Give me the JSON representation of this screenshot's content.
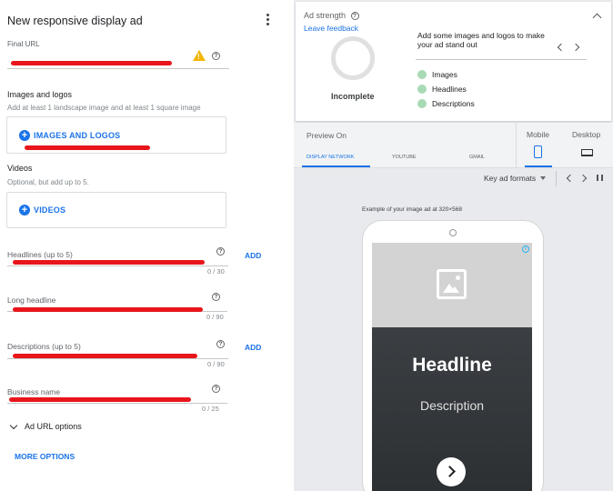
{
  "left": {
    "title": "New responsive display ad",
    "final_url": {
      "label": "Final URL"
    },
    "images": {
      "heading": "Images and logos",
      "sub": "Add at least 1 landscape image and at least 1 square image",
      "button": "IMAGES AND LOGOS"
    },
    "videos": {
      "heading": "Videos",
      "sub": "Optional, but add up to 5.",
      "button": "VIDEOS"
    },
    "headlines": {
      "label": "Headlines (up to 5)",
      "count": "0 / 30",
      "add": "ADD"
    },
    "long_headline": {
      "label": "Long headline",
      "count": "0 / 90"
    },
    "descriptions": {
      "label": "Descriptions (up to 5)",
      "count": "0 / 90",
      "add": "ADD"
    },
    "business_name": {
      "label": "Business name",
      "count": "0 / 25"
    },
    "ad_url_options": "Ad URL options",
    "more_options": "MORE OPTIONS"
  },
  "strength": {
    "title": "Ad strength",
    "feedback": "Leave feedback",
    "status": "Incomplete",
    "tip": "Add some images and logos to make your ad stand out",
    "items": [
      "Images",
      "Headlines",
      "Descriptions"
    ]
  },
  "preview": {
    "preview_on": "Preview On",
    "networks": [
      "DISPLAY NETWORK",
      "YOUTUBE",
      "GMAIL"
    ],
    "devices": [
      "Mobile",
      "Desktop"
    ],
    "formats": "Key ad formats",
    "example": "Example of your image ad at 320×568",
    "ad": {
      "headline": "Headline",
      "description": "Description"
    }
  },
  "colors": {
    "accent": "#1a73e8",
    "warning": "#f4b400",
    "redaction": "#e8151b"
  }
}
